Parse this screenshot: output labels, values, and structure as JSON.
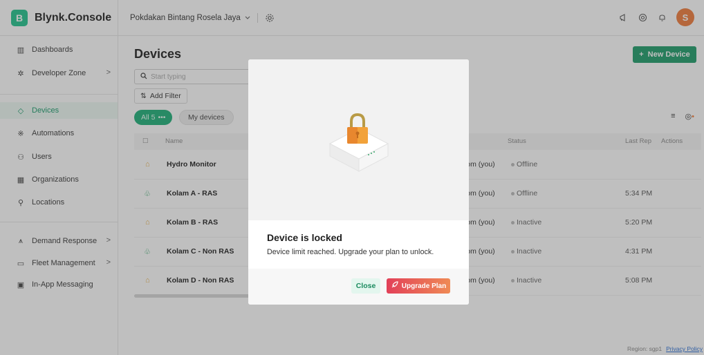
{
  "topbar": {
    "brand_letter": "B",
    "brand_name": "Blynk.Console",
    "org_name": "Pokdakan Bintang Rosela Jaya",
    "avatar_letter": "S"
  },
  "sidebar": {
    "items": [
      {
        "label": "Dashboards",
        "icon": "dashboard-icon"
      },
      {
        "label": "Developer Zone",
        "icon": "developer-icon",
        "chevron": ">"
      },
      {
        "label": "Devices",
        "icon": "devices-icon",
        "active": true
      },
      {
        "label": "Automations",
        "icon": "automations-icon"
      },
      {
        "label": "Users",
        "icon": "users-icon"
      },
      {
        "label": "Organizations",
        "icon": "organizations-icon"
      },
      {
        "label": "Locations",
        "icon": "locations-icon"
      },
      {
        "label": "Demand Response",
        "icon": "demand-response-icon",
        "chevron": ">"
      },
      {
        "label": "Fleet Management",
        "icon": "fleet-icon",
        "chevron": ">"
      },
      {
        "label": "In-App Messaging",
        "icon": "messaging-icon"
      }
    ]
  },
  "main": {
    "title": "Devices",
    "new_device_label": "New Device",
    "search_placeholder": "Start typing",
    "add_filter_label": "Add Filter",
    "chip_all_label": "All 5",
    "chip_mine_label": "My devices",
    "columns": {
      "name": "Name",
      "status": "Status",
      "last_reported": "Last Rep",
      "actions": "Actions"
    },
    "rows": [
      {
        "name": "Hydro Monitor",
        "owner": "com (you)",
        "status": "Offline",
        "last": "",
        "icon": "lock"
      },
      {
        "name": "Kolam A - RAS",
        "owner": "com (you)",
        "status": "Offline",
        "last": "5:34 PM",
        "icon": "plant"
      },
      {
        "name": "Kolam B - RAS",
        "owner": "com (you)",
        "status": "Inactive",
        "last": "5:20 PM",
        "icon": "lock"
      },
      {
        "name": "Kolam C - Non RAS",
        "owner": "com (you)",
        "status": "Inactive",
        "last": "4:31 PM",
        "icon": "plant"
      },
      {
        "name": "Kolam D - Non RAS",
        "owner": "com (you)",
        "status": "Inactive",
        "last": "5:08 PM",
        "icon": "lock"
      }
    ]
  },
  "footer": {
    "region": "Region: sgp1",
    "privacy": "Privacy Policy"
  },
  "modal": {
    "title": "Device is locked",
    "text": "Device limit reached. Upgrade your plan to unlock.",
    "close_label": "Close",
    "upgrade_label": "Upgrade Plan"
  }
}
